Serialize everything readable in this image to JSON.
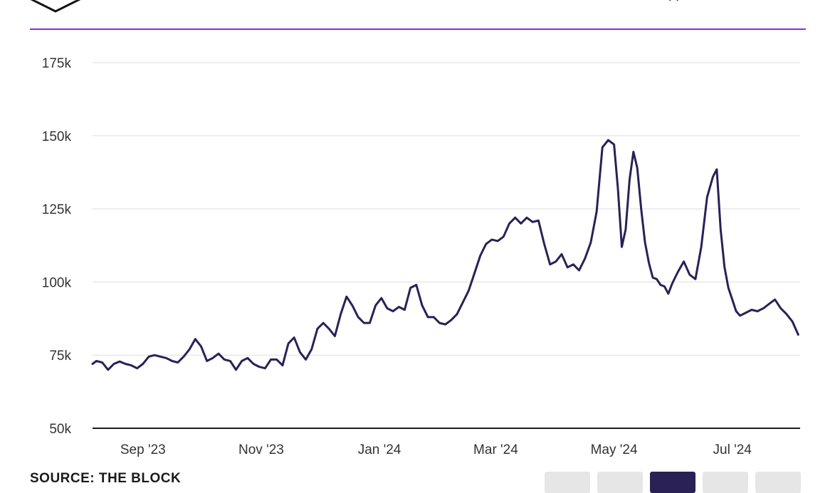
{
  "header": {
    "title_fragment": "(          )"
  },
  "source_text": "SOURCE: THE BLOCK",
  "range_buttons": [
    {
      "label": "",
      "active": false
    },
    {
      "label": "",
      "active": false
    },
    {
      "label": "",
      "active": true
    },
    {
      "label": "",
      "active": false
    },
    {
      "label": "",
      "active": false
    }
  ],
  "colors": {
    "line": "#2a2157",
    "accent": "#8a2be2",
    "grid": "#e8e8e8",
    "axis": "#1b1b1b"
  },
  "chart_data": {
    "type": "line",
    "title": "",
    "xlabel": "",
    "ylabel": "",
    "grid": true,
    "xlim": [
      "2023-08-06",
      "2024-08-05"
    ],
    "ylim": [
      50000,
      175000
    ],
    "y_ticks": [
      50000,
      75000,
      100000,
      125000,
      150000,
      175000
    ],
    "y_tick_labels": [
      "50k",
      "75k",
      "100k",
      "125k",
      "150k",
      "175k"
    ],
    "x_ticks": [
      "2023-09-01",
      "2023-11-01",
      "2024-01-01",
      "2024-03-01",
      "2024-05-01",
      "2024-07-01"
    ],
    "x_tick_labels": [
      "Sep '23",
      "Nov '23",
      "Jan '24",
      "Mar '24",
      "May '24",
      "Jul '24"
    ],
    "series": [
      {
        "name": "",
        "x": [
          "2023-08-06",
          "2023-08-08",
          "2023-08-11",
          "2023-08-14",
          "2023-08-17",
          "2023-08-20",
          "2023-08-23",
          "2023-08-26",
          "2023-08-29",
          "2023-09-01",
          "2023-09-04",
          "2023-09-07",
          "2023-09-10",
          "2023-09-13",
          "2023-09-16",
          "2023-09-19",
          "2023-09-22",
          "2023-09-25",
          "2023-09-28",
          "2023-10-01",
          "2023-10-04",
          "2023-10-07",
          "2023-10-10",
          "2023-10-13",
          "2023-10-16",
          "2023-10-19",
          "2023-10-22",
          "2023-10-25",
          "2023-10-28",
          "2023-10-31",
          "2023-11-03",
          "2023-11-06",
          "2023-11-09",
          "2023-11-12",
          "2023-11-15",
          "2023-11-18",
          "2023-11-21",
          "2023-11-24",
          "2023-11-27",
          "2023-11-30",
          "2023-12-03",
          "2023-12-06",
          "2023-12-09",
          "2023-12-12",
          "2023-12-15",
          "2023-12-18",
          "2023-12-21",
          "2023-12-24",
          "2023-12-27",
          "2023-12-30",
          "2024-01-02",
          "2024-01-05",
          "2024-01-08",
          "2024-01-11",
          "2024-01-14",
          "2024-01-17",
          "2024-01-20",
          "2024-01-23",
          "2024-01-26",
          "2024-01-29",
          "2024-02-01",
          "2024-02-04",
          "2024-02-07",
          "2024-02-10",
          "2024-02-13",
          "2024-02-16",
          "2024-02-19",
          "2024-02-22",
          "2024-02-25",
          "2024-02-28",
          "2024-03-02",
          "2024-03-05",
          "2024-03-08",
          "2024-03-11",
          "2024-03-14",
          "2024-03-17",
          "2024-03-20",
          "2024-03-23",
          "2024-03-26",
          "2024-03-29",
          "2024-04-01",
          "2024-04-04",
          "2024-04-07",
          "2024-04-10",
          "2024-04-13",
          "2024-04-16",
          "2024-04-19",
          "2024-04-22",
          "2024-04-25",
          "2024-04-28",
          "2024-05-01",
          "2024-05-03",
          "2024-05-05",
          "2024-05-07",
          "2024-05-09",
          "2024-05-11",
          "2024-05-13",
          "2024-05-15",
          "2024-05-17",
          "2024-05-19",
          "2024-05-21",
          "2024-05-23",
          "2024-05-25",
          "2024-05-27",
          "2024-05-29",
          "2024-05-31",
          "2024-06-03",
          "2024-06-06",
          "2024-06-09",
          "2024-06-12",
          "2024-06-15",
          "2024-06-18",
          "2024-06-21",
          "2024-06-23",
          "2024-06-25",
          "2024-06-27",
          "2024-06-29",
          "2024-07-01",
          "2024-07-03",
          "2024-07-05",
          "2024-07-08",
          "2024-07-11",
          "2024-07-14",
          "2024-07-17",
          "2024-07-20",
          "2024-07-23",
          "2024-07-26",
          "2024-07-29",
          "2024-08-01",
          "2024-08-04"
        ],
        "values": [
          72000,
          73000,
          72500,
          70000,
          72000,
          72800,
          72000,
          71500,
          70500,
          72000,
          74500,
          75000,
          74500,
          74000,
          73000,
          72500,
          74500,
          77000,
          80500,
          78000,
          73000,
          74000,
          75500,
          73500,
          73000,
          70000,
          73000,
          74000,
          72000,
          71000,
          70500,
          73500,
          73500,
          71500,
          79000,
          81000,
          76000,
          73500,
          77000,
          84000,
          86000,
          84000,
          81500,
          89000,
          95000,
          92000,
          88000,
          86000,
          86000,
          92000,
          94500,
          91000,
          90000,
          91500,
          90500,
          98000,
          99000,
          92000,
          88000,
          88000,
          86000,
          85500,
          87000,
          89000,
          93000,
          97000,
          103000,
          109000,
          113000,
          114500,
          114000,
          115500,
          120000,
          122000,
          120000,
          122000,
          120500,
          121000,
          113000,
          106000,
          107000,
          109500,
          105000,
          106000,
          104000,
          108000,
          113500,
          124000,
          146000,
          148500,
          147000,
          132000,
          112000,
          118000,
          135000,
          144500,
          139000,
          125000,
          113500,
          106500,
          101500,
          101000,
          99000,
          98500,
          96000,
          99500,
          103500,
          107000,
          102500,
          101000,
          112000,
          129000,
          136000,
          138500,
          118000,
          105000,
          98000,
          94000,
          90000,
          88500,
          89500,
          90500,
          90000,
          91000,
          92500,
          94000,
          91000,
          89000,
          86500,
          82000
        ],
        "color": "#2a2157"
      }
    ]
  }
}
